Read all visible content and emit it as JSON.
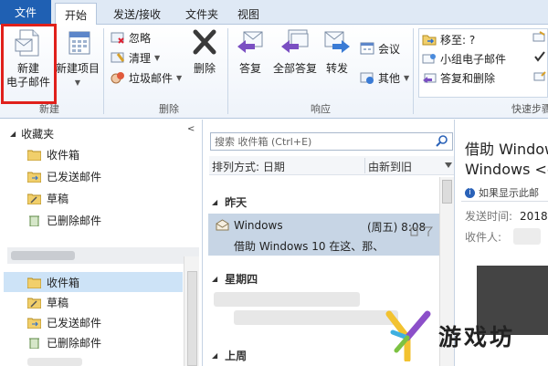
{
  "tabs": {
    "file": "文件",
    "items": [
      "开始",
      "发送/接收",
      "文件夹",
      "视图"
    ],
    "active_index": 0
  },
  "ribbon": {
    "new_group": {
      "new_email_line1": "新建",
      "new_email_line2": "电子邮件",
      "new_items_line1": "新建项目",
      "label": "新建"
    },
    "delete_group": {
      "ignore": "忽略",
      "cleanup": "清理",
      "junk": "垃圾邮件",
      "delete": "删除",
      "label": "删除"
    },
    "respond_group": {
      "reply": "答复",
      "reply_all": "全部答复",
      "forward": "转发",
      "meeting": "会议",
      "more": "其他",
      "label": "响应"
    },
    "quicksteps_group": {
      "move_to": "移至: ?",
      "team_email": "小组电子邮件",
      "reply_delete": "答复和删除",
      "label": "快速步骤"
    }
  },
  "nav": {
    "favorites_header": "收藏夹",
    "favorites": [
      "收件箱",
      "已发送邮件",
      "草稿",
      "已删除邮件"
    ],
    "account_folders": [
      "收件箱",
      "草稿",
      "已发送邮件",
      "已删除邮件"
    ],
    "selected_folder": "收件箱"
  },
  "list": {
    "search_placeholder": "搜索 收件箱 (Ctrl+E)",
    "sort_label": "排列方式: 日期",
    "sort_order": "由新到旧",
    "group_yesterday": "昨天",
    "group_thursday": "星期四",
    "group_lastweek": "上周",
    "message": {
      "from": "Windows",
      "time": "(周五) 8:08",
      "subject": "借助 Windows 10 在这、那、"
    }
  },
  "reading": {
    "title_line1": "借助 Window",
    "title_line2": "Windows <e",
    "info": "如果显示此邮",
    "sent_label": "发送时间:",
    "sent_value": "2018",
    "to_label": "收件人:"
  },
  "watermark": {
    "text": "游戏坊"
  },
  "colors": {
    "file_tab": "#1f60b3",
    "highlight_box": "#e0201b",
    "selection": "#cde3f7"
  }
}
